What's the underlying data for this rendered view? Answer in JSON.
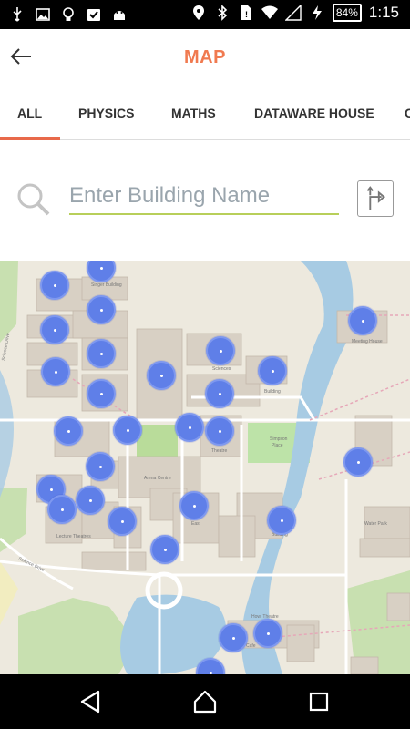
{
  "status_bar": {
    "left_icons": [
      "usb-icon",
      "image-icon",
      "lightbulb-icon",
      "clipboard-check-icon",
      "android-icon"
    ],
    "right_icons": [
      "location-icon",
      "bluetooth-icon",
      "sim-icon",
      "wifi-icon",
      "signal-icon",
      "charging-icon"
    ],
    "battery": "84%",
    "time": "1:15"
  },
  "header": {
    "title": "MAP",
    "back_icon": "arrow-left-icon"
  },
  "tabs": [
    {
      "label": "ALL",
      "selected": true
    },
    {
      "label": "PHYSICS",
      "selected": false
    },
    {
      "label": "MATHS",
      "selected": false
    },
    {
      "label": "DATAWARE HOUSE",
      "selected": false
    },
    {
      "label": "C",
      "selected": false
    }
  ],
  "search": {
    "placeholder": "Enter Building Name",
    "value": "",
    "icon": "search-icon",
    "directions_icon": "directions-icon"
  },
  "map": {
    "marker_count": 30,
    "marker_color": "#5f7fe8"
  },
  "nav_bar": {
    "back_icon": "nav-back-icon",
    "home_icon": "nav-home-icon",
    "recents_icon": "nav-recents-icon"
  },
  "colors": {
    "accent": "#f07a50",
    "tab_indicator": "#e8694a",
    "search_underline": "#b8cf5a"
  }
}
